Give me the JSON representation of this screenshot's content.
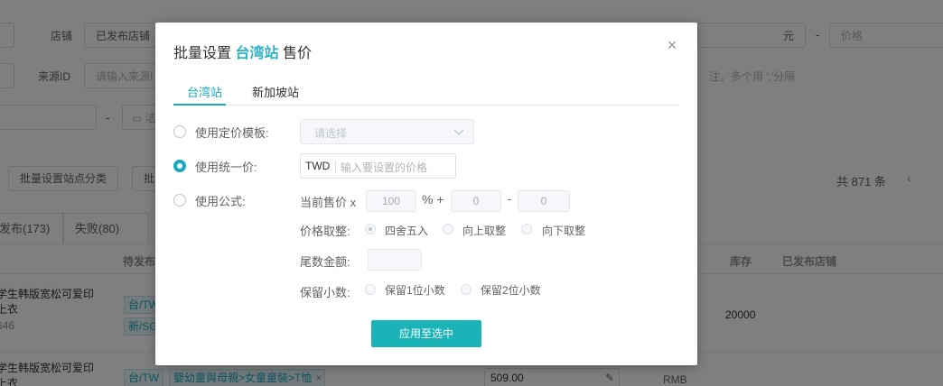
{
  "background": {
    "shop_label": "店铺",
    "shop_value": "已发布店铺",
    "source_id_label": "来源ID",
    "source_id_placeholder": "请输入来源I",
    "currency_unit": "元",
    "range_dash": "-",
    "price_placeholder": "价格",
    "multi_hint": "注。多个用 ','分隔",
    "date_dash": "-",
    "date_partial": "洁",
    "batch_category_button": "批量设置站点分类",
    "batch_partial_button": "批",
    "total_count": "共 871 条",
    "tabs": [
      "发布(173)",
      "失败(80)"
    ],
    "columns": {
      "pending": "待发布",
      "stock": "库存",
      "published_shops": "已发布店铺"
    },
    "rows": [
      {
        "title_line1": "学生韩版宽松可爱印",
        "title_line2": "上衣",
        "sub": "646",
        "tags": [
          "台/TW",
          "新/SG"
        ],
        "stock": "20000"
      },
      {
        "title_line1": "学生韩版宽松可爱印",
        "title_line2": "上衣",
        "tag": "台/TW",
        "category": "嬰幼童與母親>女童童裝>T恤",
        "price": "509.00",
        "currency": "RMB"
      }
    ]
  },
  "modal": {
    "title_prefix": "批量设置",
    "title_site": "台湾站",
    "title_suffix": "售价",
    "tabs": [
      "台湾站",
      "新加坡站"
    ],
    "active_tab": "台湾站",
    "options": {
      "template_label": "使用定价模板:",
      "template_placeholder": "请选择",
      "uniform_label": "使用统一价:",
      "currency": "TWD",
      "price_placeholder": "输入要设置的价格",
      "formula_label": "使用公式:"
    },
    "selected_option": "uniform",
    "formula": {
      "current_price_label": "当前售价 x",
      "multiplier": "100",
      "percent_plus": "% +",
      "addend": "0",
      "minus": "-",
      "subtrahend": "0",
      "rounding_label": "价格取整:",
      "rounding_options": [
        "四舍五入",
        "向上取整",
        "向下取整"
      ],
      "rounding_selected": "四舍五入",
      "tail_label": "尾数金额:",
      "decimal_label": "保留小数:",
      "decimal_options": [
        "保留1位小数",
        "保留2位小数"
      ]
    },
    "apply_button": "应用至选中"
  },
  "colors": {
    "accent": "#19a8bc",
    "apply_button": "#19b3b8"
  }
}
